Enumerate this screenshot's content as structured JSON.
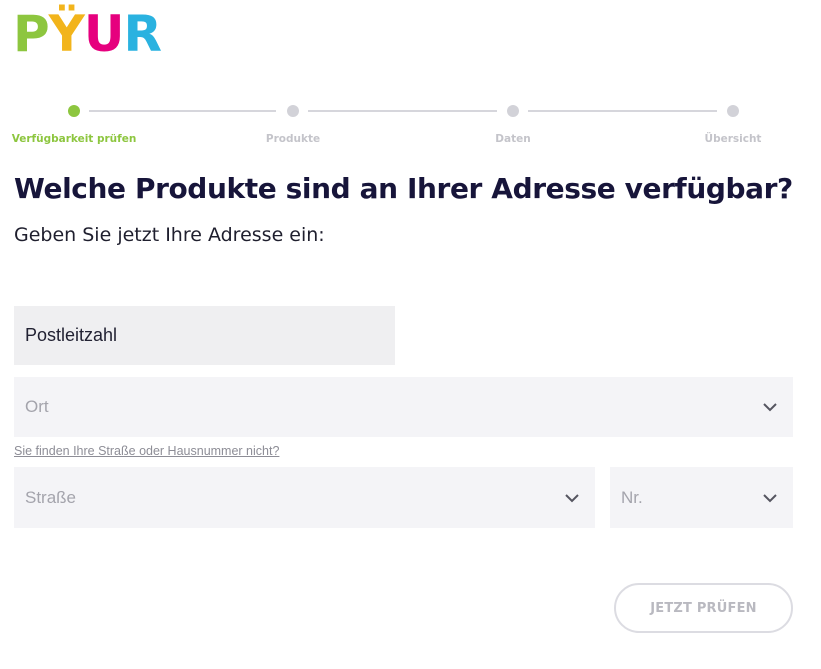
{
  "brand": {
    "logo_letters": [
      "P",
      "Ÿ",
      "U",
      "R"
    ],
    "colors": {
      "green": "#8dc63f",
      "yellow": "#f2b41b",
      "magenta": "#e6007e",
      "blue": "#2ab2e0"
    }
  },
  "stepper": {
    "steps": [
      {
        "label": "Verfügbarkeit prüfen",
        "active": true
      },
      {
        "label": "Produkte",
        "active": false
      },
      {
        "label": "Daten",
        "active": false
      },
      {
        "label": "Übersicht",
        "active": false
      }
    ]
  },
  "headline": "Welche Produkte sind an Ihrer Adresse verfügbar?",
  "subline": "Geben Sie jetzt Ihre Adresse ein:",
  "form": {
    "plz_placeholder": "Postleitzahl",
    "ort_placeholder": "Ort",
    "help_link": "Sie finden Ihre Straße oder Hausnummer nicht?",
    "strasse_placeholder": "Straße",
    "nr_placeholder": "Nr.",
    "submit_label": "JETZT PRÜFEN"
  },
  "icons": {
    "dropdown": "chevron-down-icon"
  }
}
